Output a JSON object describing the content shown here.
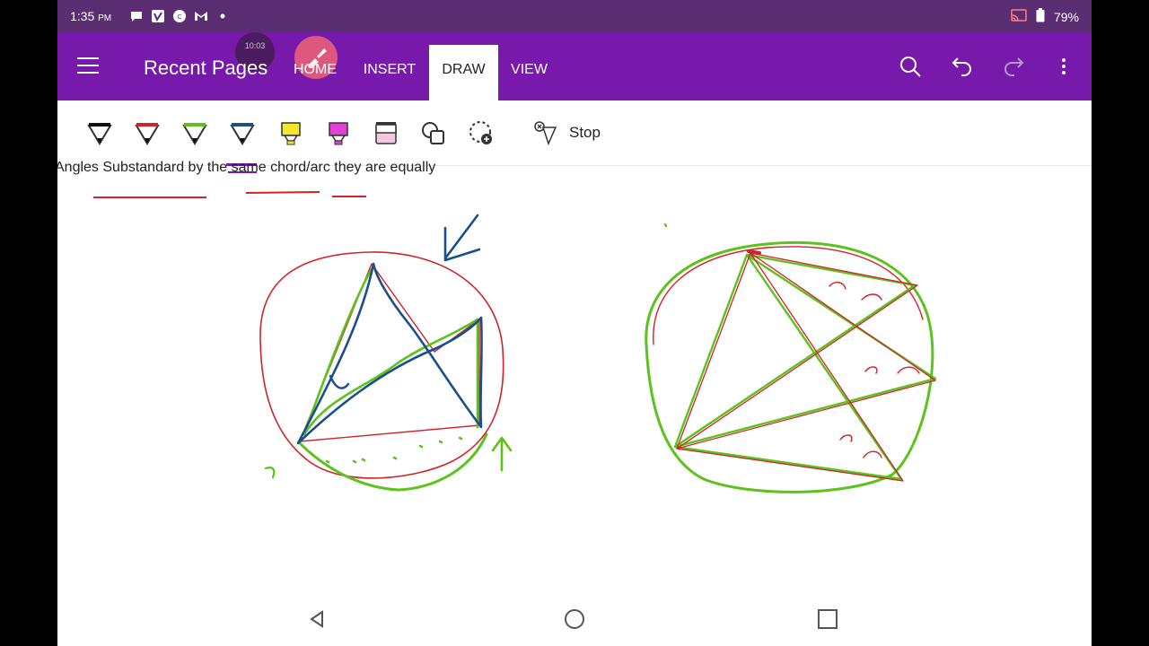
{
  "status_bar": {
    "time": "1:35",
    "time_suffix": "PM",
    "battery": "79%",
    "notification_icons": [
      "chat-icon",
      "vimeo-icon",
      "cc-icon",
      "gmail-icon",
      "dot-icon"
    ]
  },
  "toolbar": {
    "title": "Recent Pages",
    "recording_badge": "10:03",
    "tabs": [
      {
        "label": "HOME",
        "active": false
      },
      {
        "label": "INSERT",
        "active": false
      },
      {
        "label": "DRAW",
        "active": true
      },
      {
        "label": "VIEW",
        "active": false
      }
    ],
    "actions": [
      "search-icon",
      "undo-icon",
      "redo-icon",
      "more-icon"
    ]
  },
  "ribbon": {
    "tools": [
      {
        "name": "pen-black",
        "color": "#111111"
      },
      {
        "name": "pen-red",
        "color": "#d2222a"
      },
      {
        "name": "pen-green",
        "color": "#5cc21c"
      },
      {
        "name": "pen-blue",
        "color": "#1a4f8a"
      },
      {
        "name": "highlighter-yellow",
        "color": "#f5e72a"
      },
      {
        "name": "highlighter-magenta",
        "color": "#e43fd6"
      },
      {
        "name": "highlighter-pink",
        "color": "#f2c8e0"
      },
      {
        "name": "shapes",
        "color": "#333333"
      },
      {
        "name": "lasso",
        "color": "#333333"
      }
    ],
    "stop_label": "Stop"
  },
  "page": {
    "note_text": "Angles Substandard by the same chord/arc they are equally"
  },
  "colors": {
    "statusbar": "#5b2d72",
    "toolbar": "#7719aa",
    "ink_red": "#d2222a",
    "ink_green": "#5cc21c",
    "ink_blue": "#1a4f8a"
  }
}
